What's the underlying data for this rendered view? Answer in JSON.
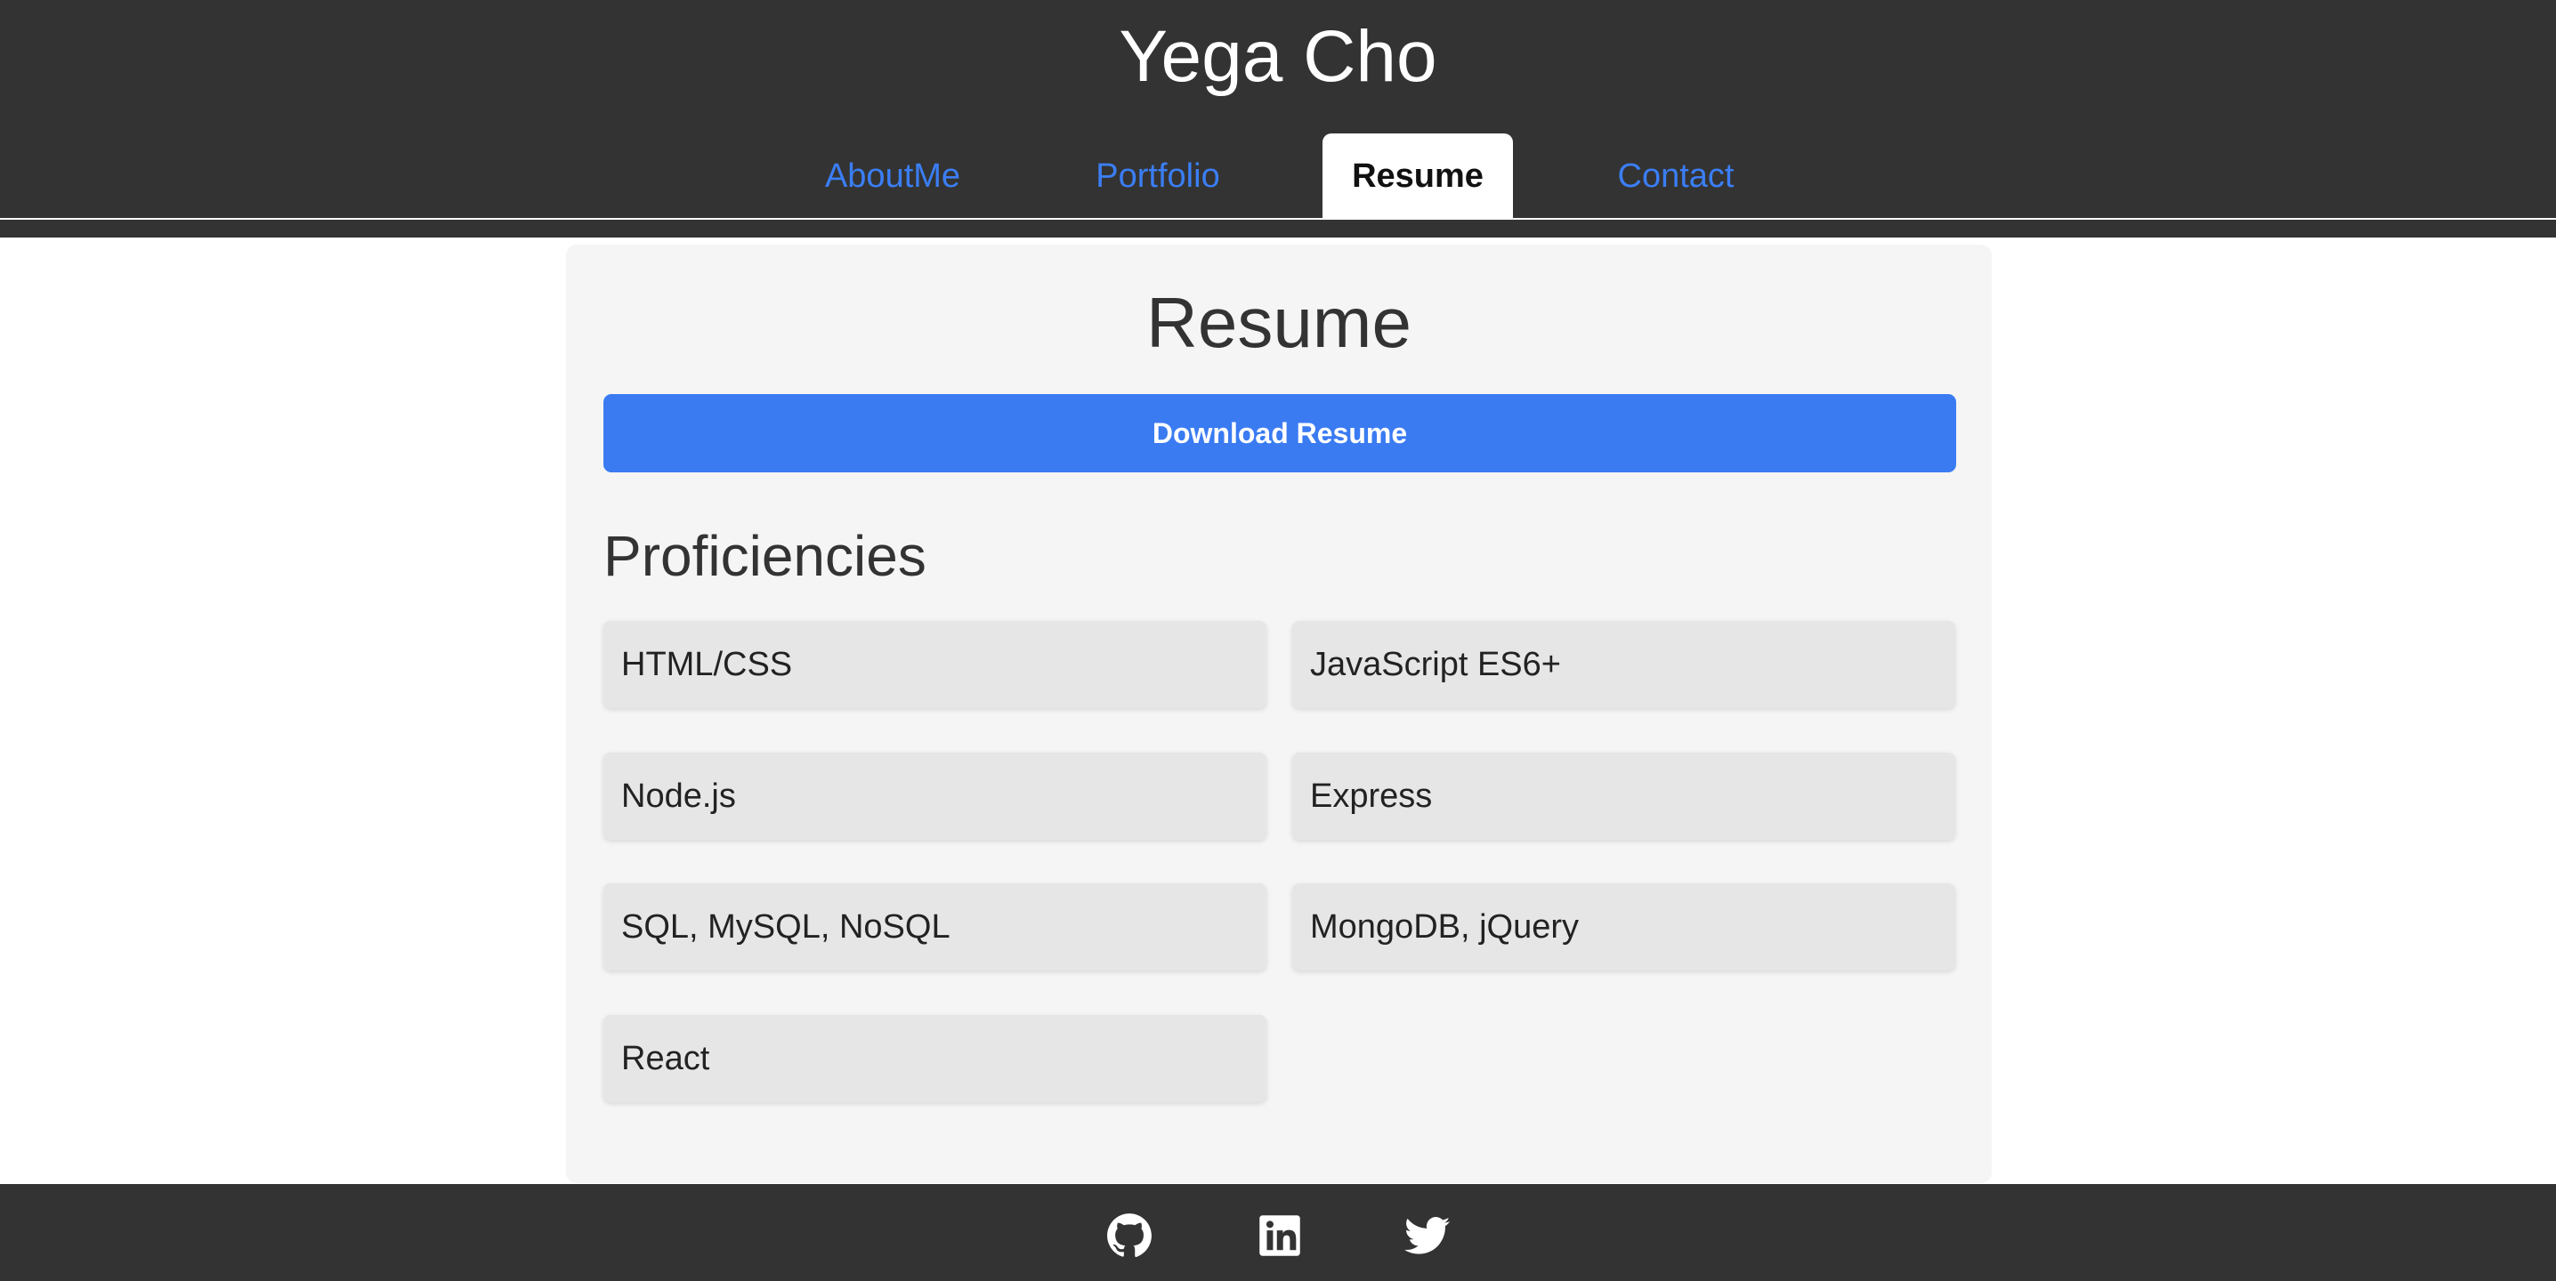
{
  "header": {
    "title": "Yega Cho",
    "nav": [
      {
        "label": "AboutMe",
        "active": false
      },
      {
        "label": "Portfolio",
        "active": false
      },
      {
        "label": "Resume",
        "active": true
      },
      {
        "label": "Contact",
        "active": false
      }
    ]
  },
  "main": {
    "title": "Resume",
    "download_label": "Download Resume",
    "proficiencies_title": "Proficiencies",
    "proficiencies": [
      "HTML/CSS",
      "JavaScript ES6+",
      "Node.js",
      "Express",
      "SQL, MySQL, NoSQL",
      "MongoDB, jQuery",
      "React"
    ]
  },
  "footer": {
    "icons": [
      "github-icon",
      "linkedin-icon",
      "twitter-icon"
    ]
  },
  "colors": {
    "header_bg": "#333333",
    "link": "#3b7ef5",
    "accent_button": "#3a7bf2",
    "card_bg": "#f5f5f5",
    "skill_bg": "#e6e6e6"
  }
}
